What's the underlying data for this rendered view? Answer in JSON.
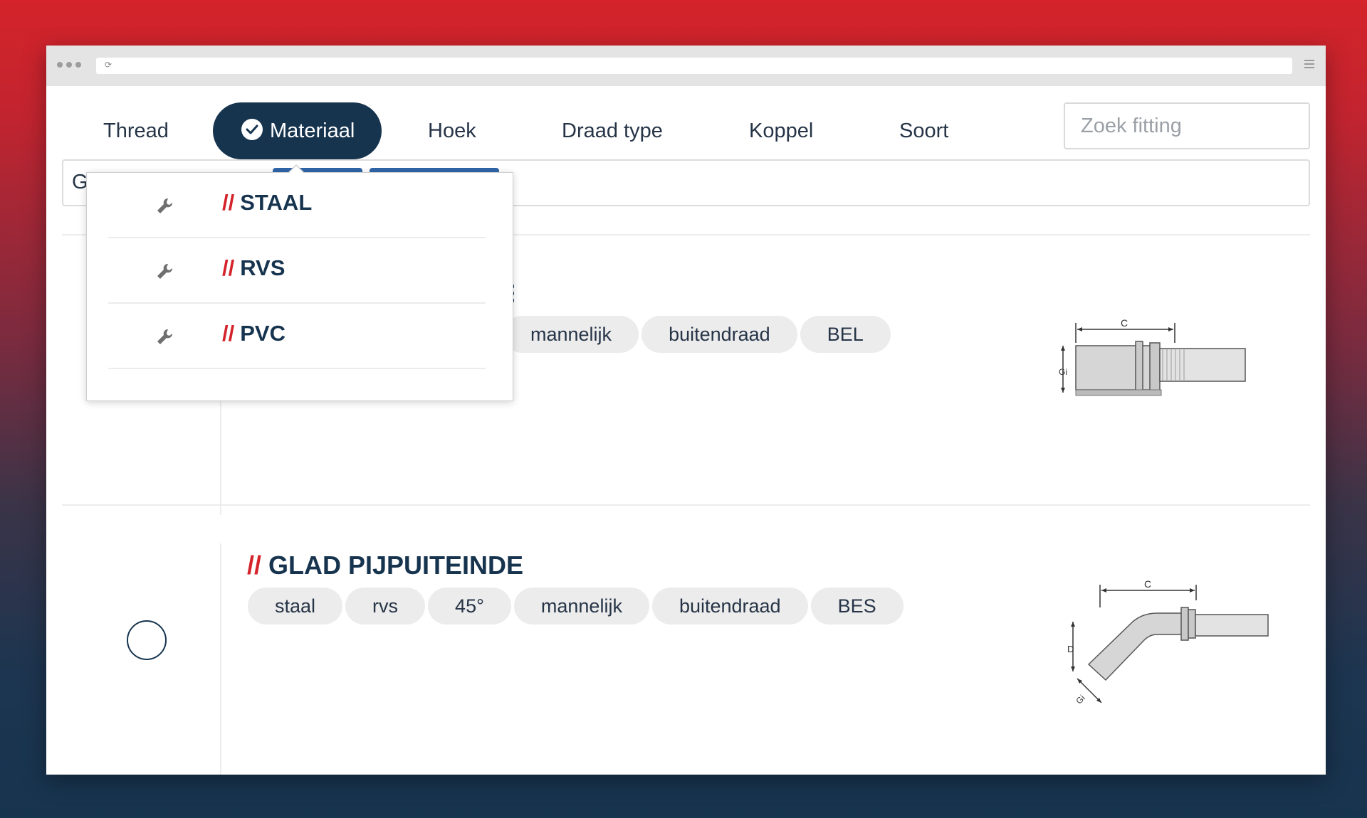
{
  "tabs": [
    {
      "label": "Thread"
    },
    {
      "label": "Materiaal"
    },
    {
      "label": "Hoek"
    },
    {
      "label": "Draad type"
    },
    {
      "label": "Koppel"
    },
    {
      "label": "Soort"
    }
  ],
  "search": {
    "placeholder": "Zoek fitting"
  },
  "filter_bar": {
    "text": "G"
  },
  "dropdown": {
    "items": [
      {
        "prefix": "//",
        "label": "STAAL"
      },
      {
        "prefix": "//",
        "label": "RVS"
      },
      {
        "prefix": "//",
        "label": "PVC"
      }
    ]
  },
  "products": [
    {
      "title": "",
      "tags": [
        "mannelijk",
        "buitendraad",
        "BEL"
      ],
      "drawing_labels": {
        "c": "C",
        "gi": "Gi"
      }
    },
    {
      "prefix": "//",
      "title": "GLAD PIJPUITEINDE",
      "tags": [
        "staal",
        "rvs",
        "45°",
        "mannelijk",
        "buitendraad",
        "BES"
      ],
      "drawing_labels": {
        "c": "C",
        "d": "D",
        "gi": "Gi"
      }
    }
  ],
  "colors": {
    "brand_navy": "#17344f",
    "accent_red": "#d4232a"
  }
}
